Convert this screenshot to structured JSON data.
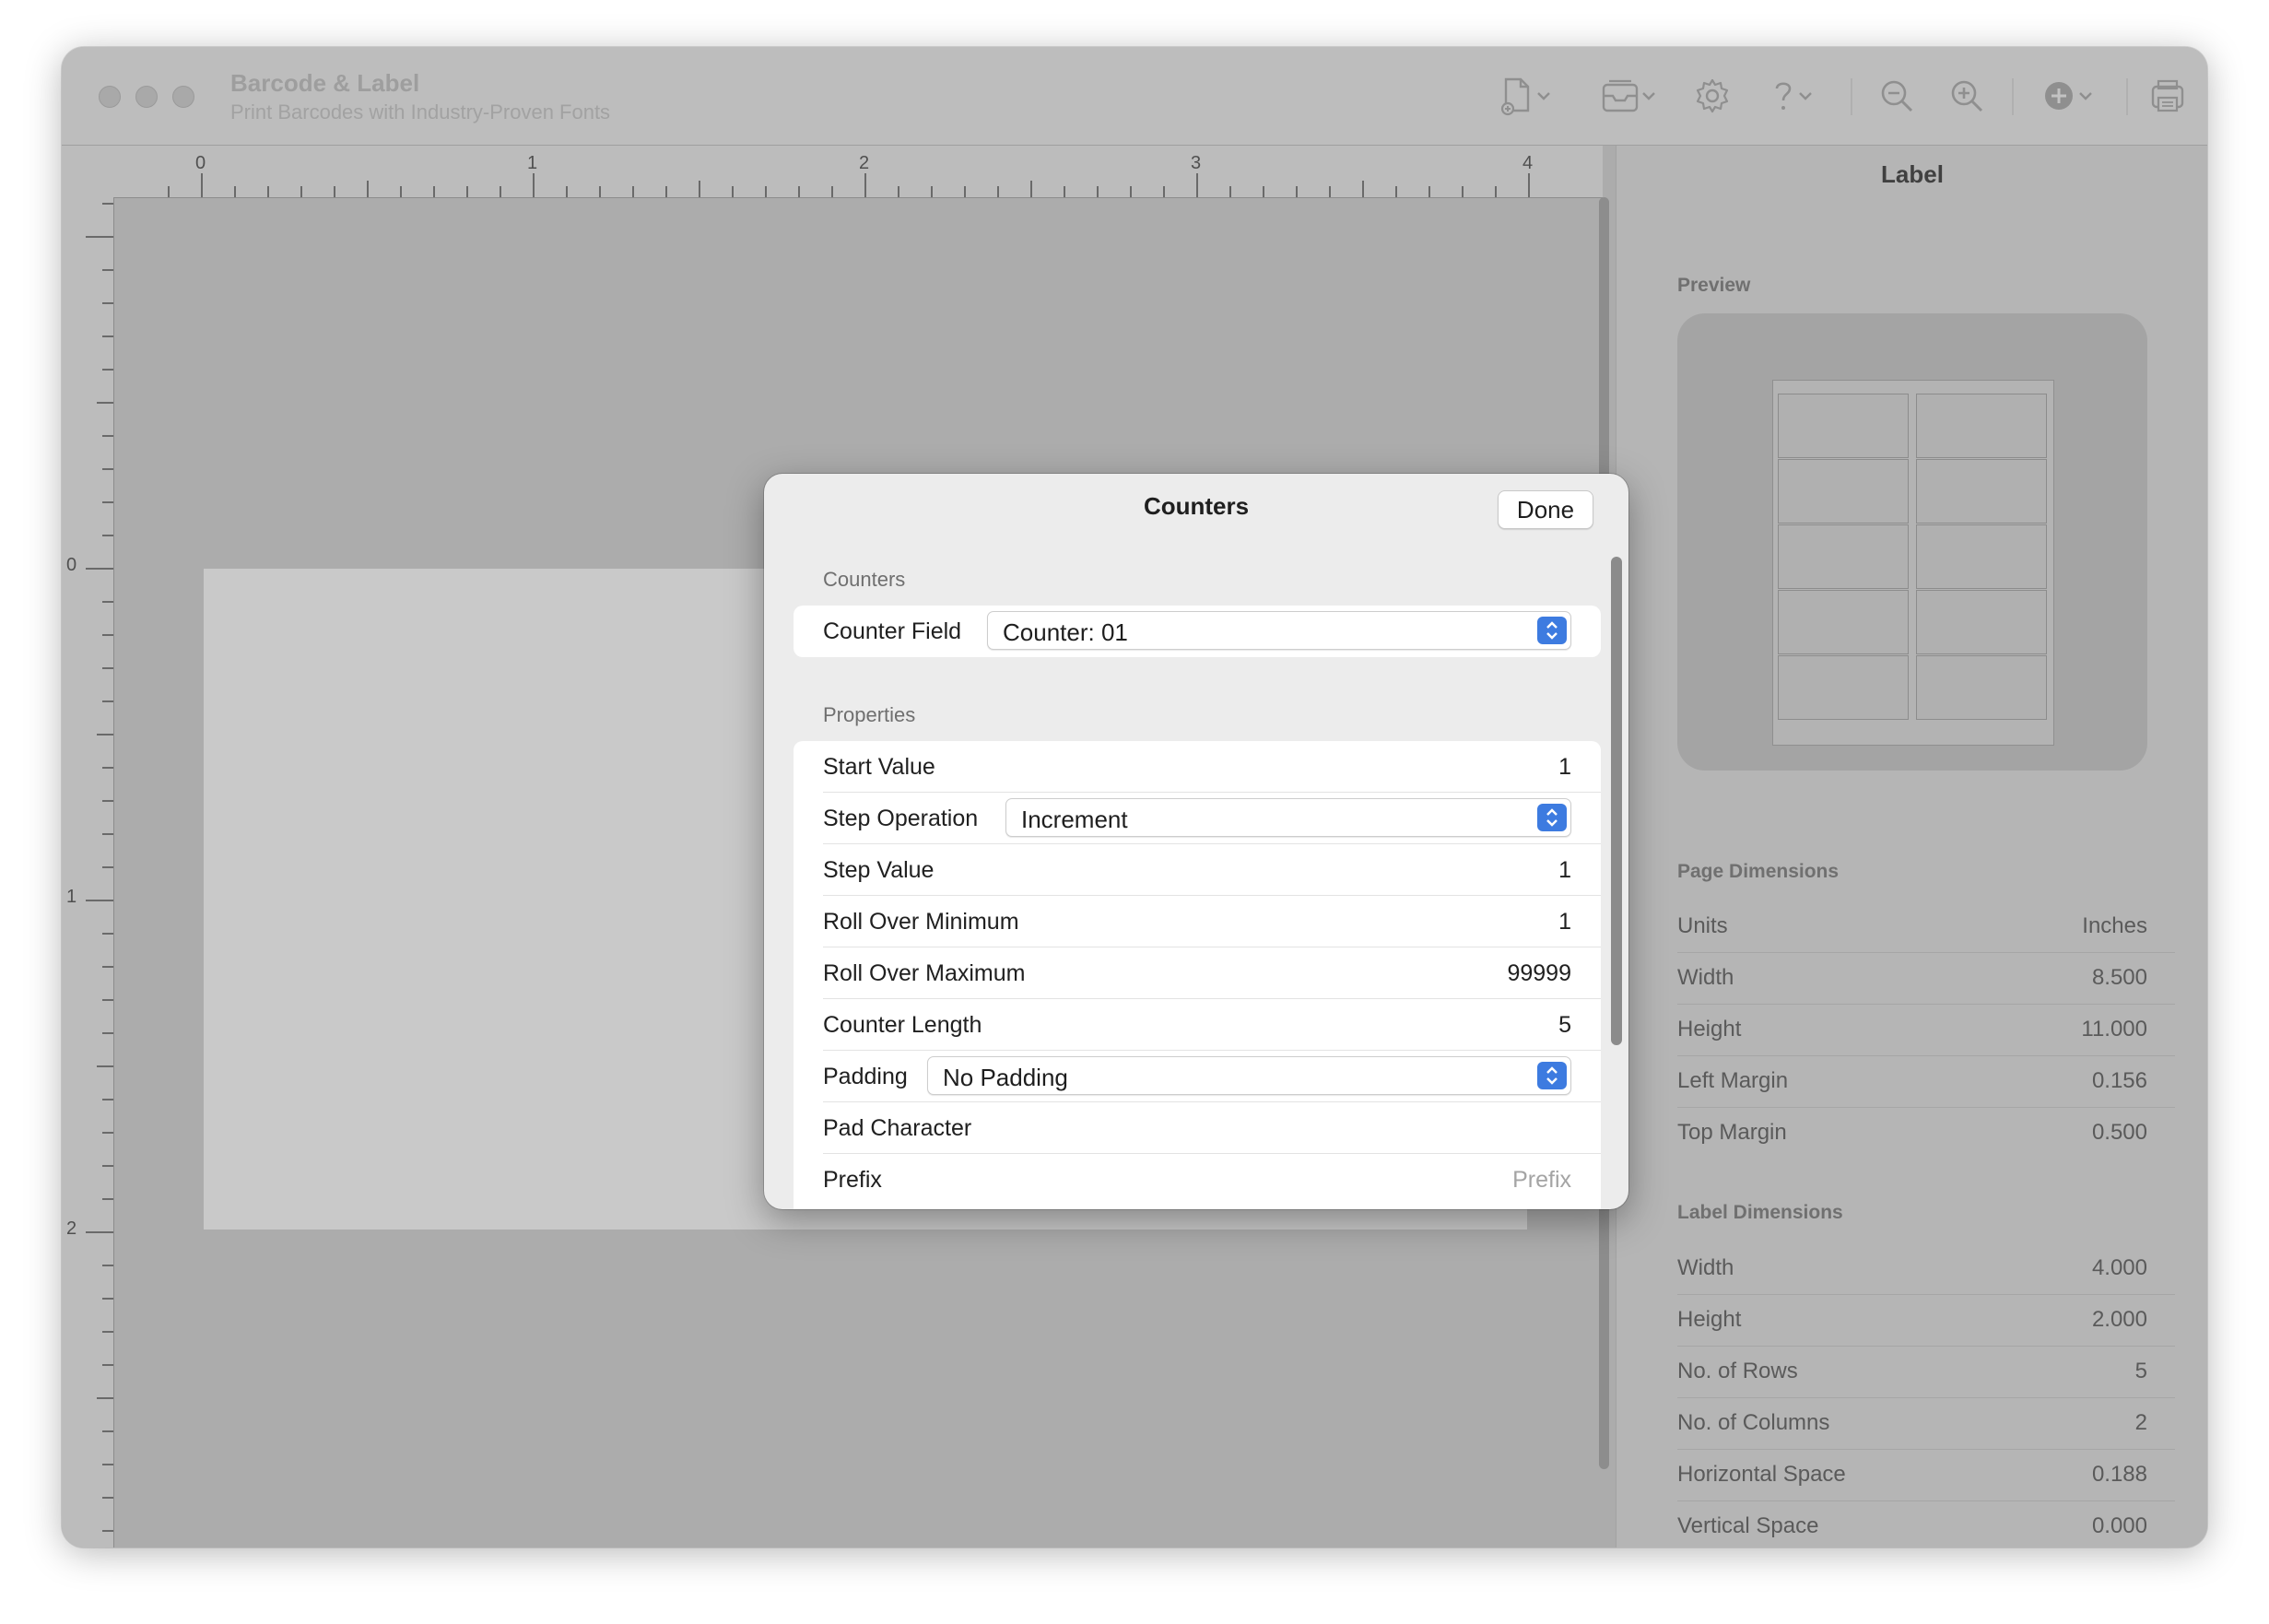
{
  "window": {
    "title": "Barcode & Label",
    "subtitle": "Print Barcodes with Industry-Proven Fonts"
  },
  "toolbar": {
    "icons": [
      "new-document-icon",
      "chevron-down-icon",
      "tray-icon",
      "gear-icon",
      "question-icon",
      "zoom-out-icon",
      "zoom-in-icon",
      "add-circle-icon",
      "print-icon"
    ]
  },
  "ruler": {
    "horizontal": [
      "0",
      "1",
      "2",
      "3",
      "4"
    ],
    "vertical": [
      "0",
      "1",
      "2"
    ]
  },
  "sheet": {
    "title": "Counters",
    "done_label": "Done",
    "counters_section": "Counters",
    "counter_field_label": "Counter Field",
    "counter_field_value": "Counter: 01",
    "properties_section": "Properties",
    "properties": {
      "start_value": {
        "label": "Start Value",
        "value": "1"
      },
      "step_operation": {
        "label": "Step Operation",
        "value": "Increment"
      },
      "step_value": {
        "label": "Step Value",
        "value": "1"
      },
      "roll_over_min": {
        "label": "Roll Over Minimum",
        "value": "1"
      },
      "roll_over_max": {
        "label": "Roll Over Maximum",
        "value": "99999"
      },
      "counter_length": {
        "label": "Counter Length",
        "value": "5"
      },
      "padding": {
        "label": "Padding",
        "value": "No Padding"
      },
      "pad_character": {
        "label": "Pad Character",
        "value": ""
      },
      "prefix": {
        "label": "Prefix",
        "placeholder": "Prefix"
      }
    }
  },
  "sidebar": {
    "title": "Label",
    "preview_label": "Preview",
    "preview": {
      "rows": 5,
      "columns": 2
    },
    "page_dimensions_label": "Page Dimensions",
    "page_dimensions": [
      {
        "label": "Units",
        "value": "Inches"
      },
      {
        "label": "Width",
        "value": "8.500"
      },
      {
        "label": "Height",
        "value": "11.000"
      },
      {
        "label": "Left Margin",
        "value": "0.156"
      },
      {
        "label": "Top Margin",
        "value": "0.500"
      }
    ],
    "label_dimensions_label": "Label Dimensions",
    "label_dimensions": [
      {
        "label": "Width",
        "value": "4.000"
      },
      {
        "label": "Height",
        "value": "2.000"
      },
      {
        "label": "No. of Rows",
        "value": "5"
      },
      {
        "label": "No. of Columns",
        "value": "2"
      },
      {
        "label": "Horizontal Space",
        "value": "0.188"
      },
      {
        "label": "Vertical Space",
        "value": "0.000"
      }
    ]
  }
}
